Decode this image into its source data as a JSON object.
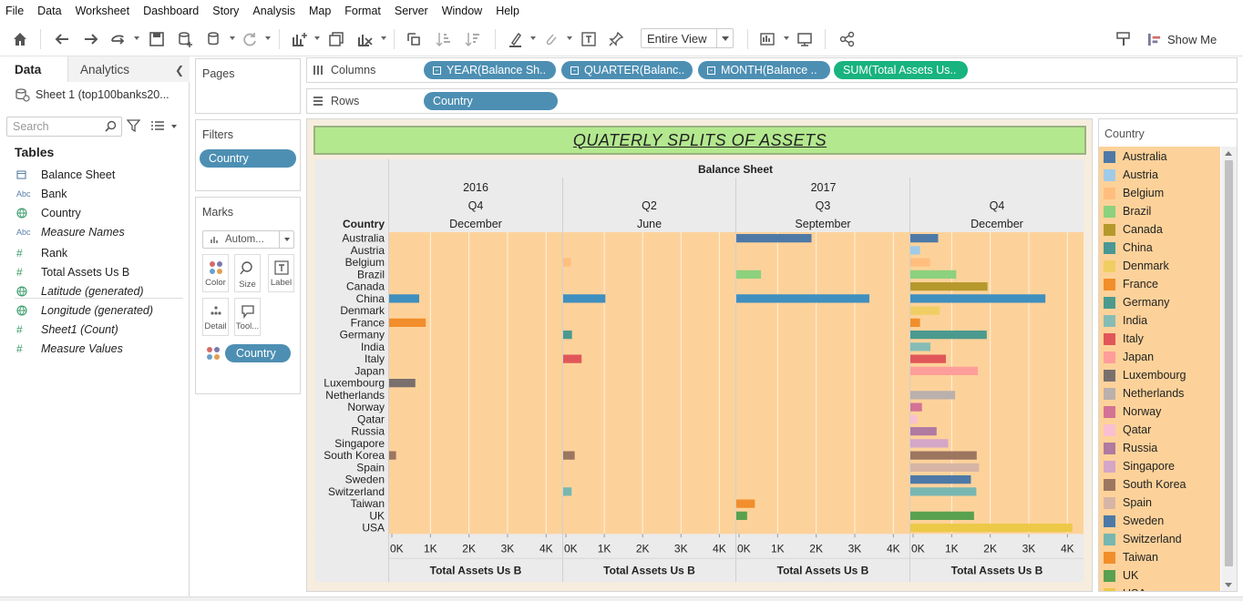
{
  "menu": [
    "File",
    "Data",
    "Worksheet",
    "Dashboard",
    "Story",
    "Analysis",
    "Map",
    "Format",
    "Server",
    "Window",
    "Help"
  ],
  "toolbar": {
    "view_mode": "Entire View",
    "show_me": "Show Me"
  },
  "data_pane": {
    "tabs": [
      "Data",
      "Analytics"
    ],
    "source": "Sheet 1 (top100banks20...",
    "search_placeholder": "Search",
    "tables_title": "Tables",
    "fields": [
      {
        "type": "date",
        "label": "Balance Sheet",
        "italic": false
      },
      {
        "type": "Abc",
        "label": "Bank",
        "italic": false
      },
      {
        "type": "geo",
        "label": "Country",
        "italic": false
      },
      {
        "type": "Abc",
        "label": "Measure Names",
        "italic": true
      },
      {
        "type": "#",
        "label": "Rank",
        "italic": false
      },
      {
        "type": "#",
        "label": "Total Assets Us B",
        "italic": false
      },
      {
        "type": "geo",
        "label": "Latitude (generated)",
        "italic": true
      },
      {
        "type": "geo",
        "label": "Longitude (generated)",
        "italic": true
      },
      {
        "type": "#",
        "label": "Sheet1 (Count)",
        "italic": true
      },
      {
        "type": "#",
        "label": "Measure Values",
        "italic": true
      }
    ]
  },
  "pages": {
    "title": "Pages"
  },
  "filters": {
    "title": "Filters",
    "pill": "Country"
  },
  "marks": {
    "title": "Marks",
    "mark_type": "Autom...",
    "buttons": [
      "Color",
      "Size",
      "Label",
      "Detail",
      "Tool..."
    ],
    "color_pill": "Country"
  },
  "columns": {
    "label": "Columns",
    "pills": [
      {
        "text": "YEAR(Balance Sh..",
        "kind": "dim"
      },
      {
        "text": "QUARTER(Balanc..",
        "kind": "dim"
      },
      {
        "text": "MONTH(Balance ..",
        "kind": "dim"
      },
      {
        "text": "SUM(Total Assets Us..",
        "kind": "measure"
      }
    ]
  },
  "rows": {
    "label": "Rows",
    "pills": [
      {
        "text": "Country"
      }
    ]
  },
  "legend": {
    "title": "Country",
    "items": [
      {
        "name": "Australia",
        "color": "#4e79a7"
      },
      {
        "name": "Austria",
        "color": "#a0cbe8"
      },
      {
        "name": "Belgium",
        "color": "#ffbe7d"
      },
      {
        "name": "Brazil",
        "color": "#8cd17d"
      },
      {
        "name": "Canada",
        "color": "#b6992d"
      },
      {
        "name": "China",
        "color": "#499894"
      },
      {
        "name": "Denmark",
        "color": "#f1ce63"
      },
      {
        "name": "France",
        "color": "#f28e2b"
      },
      {
        "name": "Germany",
        "color": "#4c9a8f"
      },
      {
        "name": "India",
        "color": "#86bcb6"
      },
      {
        "name": "Italy",
        "color": "#e15759"
      },
      {
        "name": "Japan",
        "color": "#ff9d9a"
      },
      {
        "name": "Luxembourg",
        "color": "#79706e"
      },
      {
        "name": "Netherlands",
        "color": "#bab0ac"
      },
      {
        "name": "Norway",
        "color": "#d37295"
      },
      {
        "name": "Qatar",
        "color": "#fabfd2"
      },
      {
        "name": "Russia",
        "color": "#b07aa1"
      },
      {
        "name": "Singapore",
        "color": "#d4a6c8"
      },
      {
        "name": "South Korea",
        "color": "#9d7660"
      },
      {
        "name": "Spain",
        "color": "#d7b5a6"
      },
      {
        "name": "Sweden",
        "color": "#4e79a7"
      },
      {
        "name": "Switzerland",
        "color": "#76b7b2"
      },
      {
        "name": "Taiwan",
        "color": "#f28e2b"
      },
      {
        "name": "UK",
        "color": "#59a14f"
      },
      {
        "name": "USA",
        "color": "#edc948"
      }
    ]
  },
  "chart_data": {
    "type": "bar",
    "title": "QUATERLY SPLITS OF ASSETS",
    "header_title": "Balance Sheet",
    "row_header": "Country",
    "background": "#fdd29a",
    "categories": [
      "Australia",
      "Austria",
      "Belgium",
      "Brazil",
      "Canada",
      "China",
      "Denmark",
      "France",
      "Germany",
      "India",
      "Italy",
      "Japan",
      "Luxembourg",
      "Netherlands",
      "Norway",
      "Qatar",
      "Russia",
      "Singapore",
      "South Korea",
      "Spain",
      "Sweden",
      "Switzerland",
      "Taiwan",
      "UK",
      "USA"
    ],
    "bar_colors": {
      "Australia": "#4e79a7",
      "China": "#3f8fbf",
      "France": "#f28e2b",
      "Brazil": "#8cd17d",
      "Germany": "#4c9a8f",
      "Italy": "#e15759",
      "Luxembourg": "#79706e",
      "South Korea": "#9d7660",
      "Switzerland": "#76b7b2",
      "Taiwan": "#f28e2b",
      "UK": "#59a14f",
      "Belgium": "#ffbe7d",
      "Austria": "#a0cbe8",
      "Canada": "#b6992d",
      "Denmark": "#f1ce63",
      "India": "#86bcb6",
      "Japan": "#ff9d9a",
      "Netherlands": "#bab0ac",
      "Norway": "#d37295",
      "Qatar": "#fabfd2",
      "Russia": "#b07aa1",
      "Singapore": "#d4a6c8",
      "Spain": "#d7b5a6",
      "Sweden": "#4e79a7",
      "USA": "#edc948"
    },
    "x_axis": {
      "label": "Total Assets Us B",
      "ticks": [
        "0K",
        "1K",
        "2K",
        "3K",
        "4K"
      ],
      "range": [
        0,
        4300
      ]
    },
    "year_groups": [
      {
        "year": "2016",
        "span": 1
      },
      {
        "year": "2017",
        "span": 3
      }
    ],
    "panes": [
      {
        "quarter": "Q4",
        "month": "December",
        "values": {
          "China": 780,
          "France": 950,
          "Luxembourg": 680,
          "South Korea": 180
        }
      },
      {
        "quarter": "Q2",
        "month": "June",
        "values": {
          "Belgium": 200,
          "China": 1100,
          "Germany": 230,
          "Italy": 480,
          "South Korea": 300,
          "Switzerland": 220
        }
      },
      {
        "quarter": "Q3",
        "month": "September",
        "values": {
          "Australia": 1950,
          "Brazil": 640,
          "China": 3450,
          "Taiwan": 480,
          "UK": 280
        }
      },
      {
        "quarter": "Q4",
        "month": "December",
        "values": {
          "Australia": 720,
          "Austria": 250,
          "Belgium": 510,
          "Brazil": 1190,
          "Canada": 2000,
          "China": 3500,
          "Denmark": 760,
          "France": 250,
          "Germany": 1980,
          "India": 520,
          "Italy": 920,
          "Japan": 1750,
          "Netherlands": 1160,
          "Norway": 300,
          "Qatar": 180,
          "Russia": 680,
          "Singapore": 980,
          "South Korea": 1720,
          "Spain": 1780,
          "Sweden": 1570,
          "Switzerland": 1710,
          "UK": 1650,
          "USA": 4200
        }
      }
    ]
  }
}
